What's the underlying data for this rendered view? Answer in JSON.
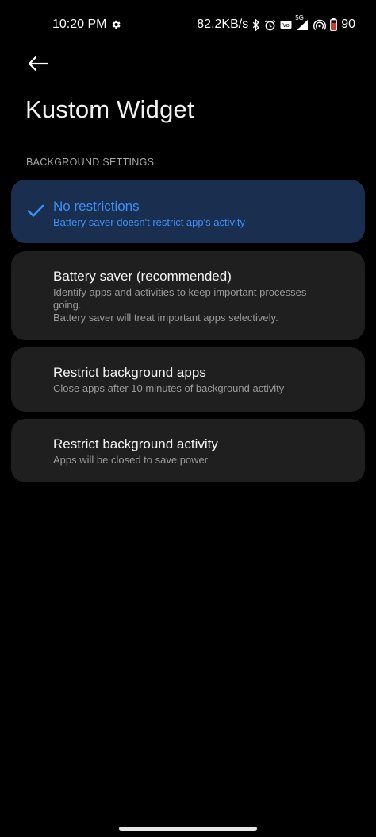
{
  "status_bar": {
    "time": "10:20 PM",
    "network_speed": "82.2KB/s",
    "network_label": "5G",
    "battery_level": "90",
    "icons": [
      "gear-icon",
      "bluetooth-icon",
      "alarm-icon",
      "volte-icon",
      "signal-icon",
      "hotspot-icon",
      "battery-icon"
    ]
  },
  "header": {
    "back_icon": "arrow-left-icon",
    "title": "Kustom Widget"
  },
  "section": {
    "title": "BACKGROUND SETTINGS"
  },
  "options": [
    {
      "title": "No restrictions",
      "description_lines": [
        "Battery saver doesn't restrict app's activity"
      ],
      "selected": true
    },
    {
      "title": "Battery saver (recommended)",
      "description_lines": [
        "Identify apps and activities to keep important processes",
        "going.",
        "Battery saver will treat important apps selectively."
      ],
      "selected": false
    },
    {
      "title": "Restrict background apps",
      "description_lines": [
        "Close apps after 10 minutes of background activity"
      ],
      "selected": false
    },
    {
      "title": "Restrict background activity",
      "description_lines": [
        "Apps will be closed to save power"
      ],
      "selected": false
    }
  ],
  "colors": {
    "background": "#000000",
    "card": "#1f1f1f",
    "selected_card": "#1a2f4f",
    "accent": "#3d8ef5",
    "battery_low": "#e0312c"
  }
}
